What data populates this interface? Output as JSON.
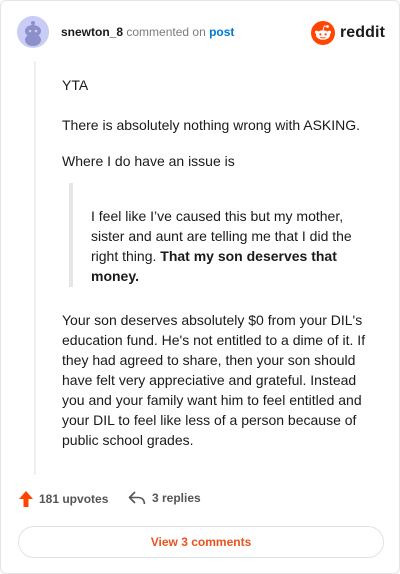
{
  "header": {
    "username": "snewton_8",
    "action_text": "commented on",
    "post_link": "post",
    "brand_name": "reddit"
  },
  "comment": {
    "paragraphs": [
      "YTA",
      "There is absolutely nothing wrong with ASKING.",
      "Where I do have an issue is"
    ],
    "quote_plain": "I feel like I’ve caused this but my mother, sister and aunt are telling me that I did the right thing. ",
    "quote_bold": "That my son deserves that money.",
    "body": "Your son deserves absolutely $0 from your DIL's education fund. He's not entitled to a dime of it. If they had agreed to share, then your son should have felt very appreciative and grateful. Instead you and your family want him to feel entitled and your DIL to feel like less of a person because of public school grades."
  },
  "actions": {
    "upvotes": "181 upvotes",
    "replies": "3 replies"
  },
  "footer": {
    "view_comments": "View 3 comments"
  },
  "colors": {
    "accent": "#ff4500",
    "link": "#0079d3",
    "button_text": "#e8541c"
  },
  "icons": [
    "snoo-avatar-icon",
    "reddit-logo-icon",
    "upvote-arrow-icon",
    "reply-arrow-icon"
  ]
}
